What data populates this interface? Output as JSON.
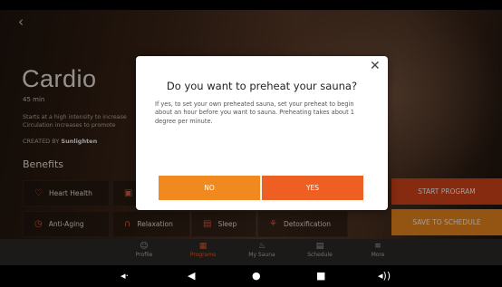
{
  "program": {
    "back_icon": "chevron-left-icon",
    "title": "Cardio",
    "duration": "45 min",
    "description_lines": [
      "Starts at a high intensity to increase",
      "Circulation increases to promote"
    ],
    "created_by_label": "CREATED BY",
    "created_by_name": "Sunlighten",
    "benefits_heading": "Benefits",
    "benefits": [
      {
        "label": "Heart Health",
        "icon": "heart-icon"
      },
      {
        "label": "",
        "icon": "weight-icon"
      },
      {
        "label": "Anti-Aging",
        "icon": "clock-icon"
      },
      {
        "label": "Relaxation",
        "icon": "yoga-icon"
      },
      {
        "label": "Sleep",
        "icon": "sleep-icon"
      },
      {
        "label": "Detoxification",
        "icon": "detox-icon"
      }
    ],
    "start_program_label": "START PROGRAM",
    "save_schedule_label": "SAVE TO SCHEDULE"
  },
  "nav": {
    "items": [
      {
        "label": "Profile",
        "icon": "person-icon"
      },
      {
        "label": "Programs",
        "icon": "grid-icon"
      },
      {
        "label": "My Sauna",
        "icon": "sauna-icon"
      },
      {
        "label": "Schedule",
        "icon": "calendar-icon"
      },
      {
        "label": "More",
        "icon": "menu-icon"
      }
    ],
    "active": "Programs"
  },
  "dialog": {
    "title": "Do you want to preheat your sauna?",
    "body": "If yes, to set your own preheated sauna, set your preheat to begin about an hour before you want to sauna. Preheating takes about 1 degree per minute.",
    "no_label": "NO",
    "yes_label": "YES",
    "close_icon": "close-icon"
  },
  "system_bar": {
    "buttons": [
      "volume-down-icon",
      "back-icon",
      "home-icon",
      "recents-icon",
      "volume-up-icon"
    ]
  },
  "colors": {
    "accent_orange": "#f08a1e",
    "accent_red_orange": "#ef5f22",
    "start_program_bg": "#d8441a",
    "save_schedule_bg": "#f08a1e"
  }
}
